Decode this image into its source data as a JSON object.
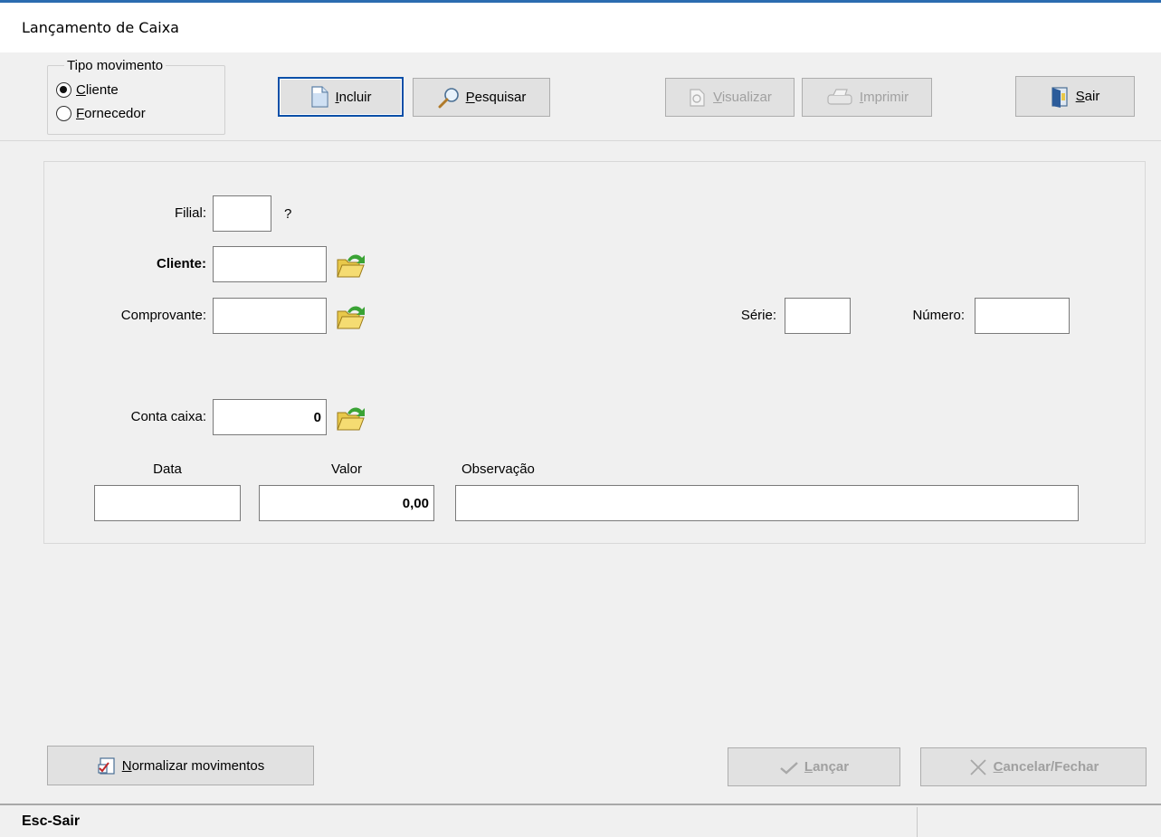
{
  "window": {
    "title": "Lançamento de Caixa"
  },
  "tipo_movimento": {
    "legend": "Tipo movimento",
    "options": [
      {
        "label": "Cliente",
        "checked": true
      },
      {
        "label": "Fornecedor",
        "checked": false
      }
    ]
  },
  "toolbar": {
    "incluir": "Incluir",
    "pesquisar": "Pesquisar",
    "visualizar": "Visualizar",
    "imprimir": "Imprimir",
    "sair": "Sair"
  },
  "form": {
    "filial_label": "Filial:",
    "filial_hint": "?",
    "cliente_label": "Cliente:",
    "comprovante_label": "Comprovante:",
    "serie_label": "Série:",
    "numero_label": "Número:",
    "conta_caixa_label": "Conta caixa:",
    "conta_caixa_value": "0",
    "data_label": "Data",
    "valor_label": "Valor",
    "valor_value": "0,00",
    "observacao_label": "Observação"
  },
  "footer": {
    "normalizar": "Normalizar movimentos",
    "lancar": "Lançar",
    "cancelar": "Cancelar/Fechar"
  },
  "status": {
    "text": "Esc-Sair"
  },
  "colors": {
    "accent": "#0a4fa8",
    "folder": "#e8c84a",
    "arrow": "#3aa335"
  }
}
